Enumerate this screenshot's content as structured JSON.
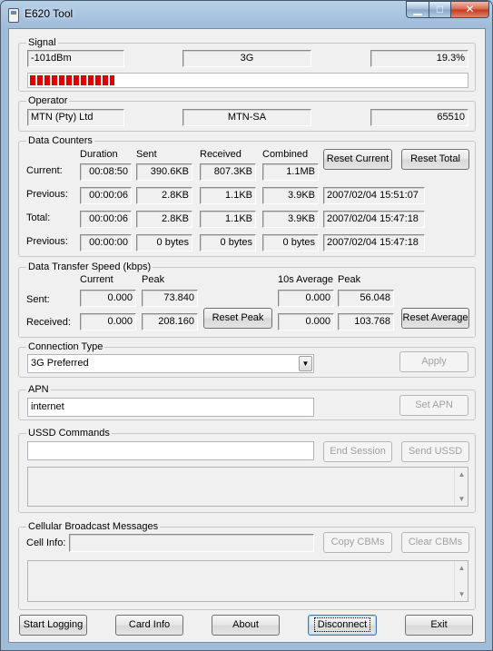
{
  "window": {
    "title": "E620 Tool",
    "minimize": "▁",
    "maximize": "□",
    "close": "✕"
  },
  "signal": {
    "legend": "Signal",
    "strength": "-101dBm",
    "network_type": "3G",
    "percent": "19.3%",
    "level": 0.193
  },
  "operator": {
    "legend": "Operator",
    "long_name": "MTN (Pty) Ltd",
    "short_name": "MTN-SA",
    "code": "65510"
  },
  "data_counters": {
    "legend": "Data Counters",
    "headers": {
      "duration": "Duration",
      "sent": "Sent",
      "received": "Received",
      "combined": "Combined"
    },
    "rows": [
      {
        "label": "Current:",
        "duration": "00:08:50",
        "sent": "390.6KB",
        "received": "807.3KB",
        "combined": "1.1MB",
        "timestamp": ""
      },
      {
        "label": "Previous:",
        "duration": "00:00:06",
        "sent": "2.8KB",
        "received": "1.1KB",
        "combined": "3.9KB",
        "timestamp": "2007/02/04 15:51:07"
      },
      {
        "label": "Total:",
        "duration": "00:00:06",
        "sent": "2.8KB",
        "received": "1.1KB",
        "combined": "3.9KB",
        "timestamp": "2007/02/04 15:47:18"
      },
      {
        "label": "Previous:",
        "duration": "00:00:00",
        "sent": "0 bytes",
        "received": "0 bytes",
        "combined": "0 bytes",
        "timestamp": "2007/02/04 15:47:18"
      }
    ],
    "reset_current": "Reset Current",
    "reset_total": "Reset Total"
  },
  "speed": {
    "legend": "Data Transfer Speed (kbps)",
    "headers": {
      "current": "Current",
      "peak": "Peak",
      "avg": "10s Average",
      "avg_peak": "Peak"
    },
    "sent": {
      "label": "Sent:",
      "current": "0.000",
      "peak": "73.840",
      "avg": "0.000",
      "avg_peak": "56.048"
    },
    "received": {
      "label": "Received:",
      "current": "0.000",
      "peak": "208.160",
      "avg": "0.000",
      "avg_peak": "103.768"
    },
    "reset_peak": "Reset Peak",
    "reset_average": "Reset Average"
  },
  "connection": {
    "legend": "Connection Type",
    "selected": "3G Preferred",
    "apply": "Apply"
  },
  "apn": {
    "legend": "APN",
    "value": "internet",
    "set_apn": "Set APN"
  },
  "ussd": {
    "legend": "USSD Commands",
    "value": "",
    "end_session": "End Session",
    "send_ussd": "Send USSD"
  },
  "cbm": {
    "legend": "Cellular Broadcast Messages",
    "cell_info_label": "Cell Info:",
    "cell_info": "",
    "copy": "Copy CBMs",
    "clear": "Clear CBMs"
  },
  "footer": {
    "start_logging": "Start Logging",
    "card_info": "Card Info",
    "about": "About",
    "disconnect": "Disconnect",
    "exit": "Exit"
  },
  "colors": {
    "signal_bar": "#e00000",
    "focus_border": "#3c7fb1"
  },
  "scroll": {
    "up": "▲",
    "down": "▼"
  },
  "combo_arrow": "▼"
}
